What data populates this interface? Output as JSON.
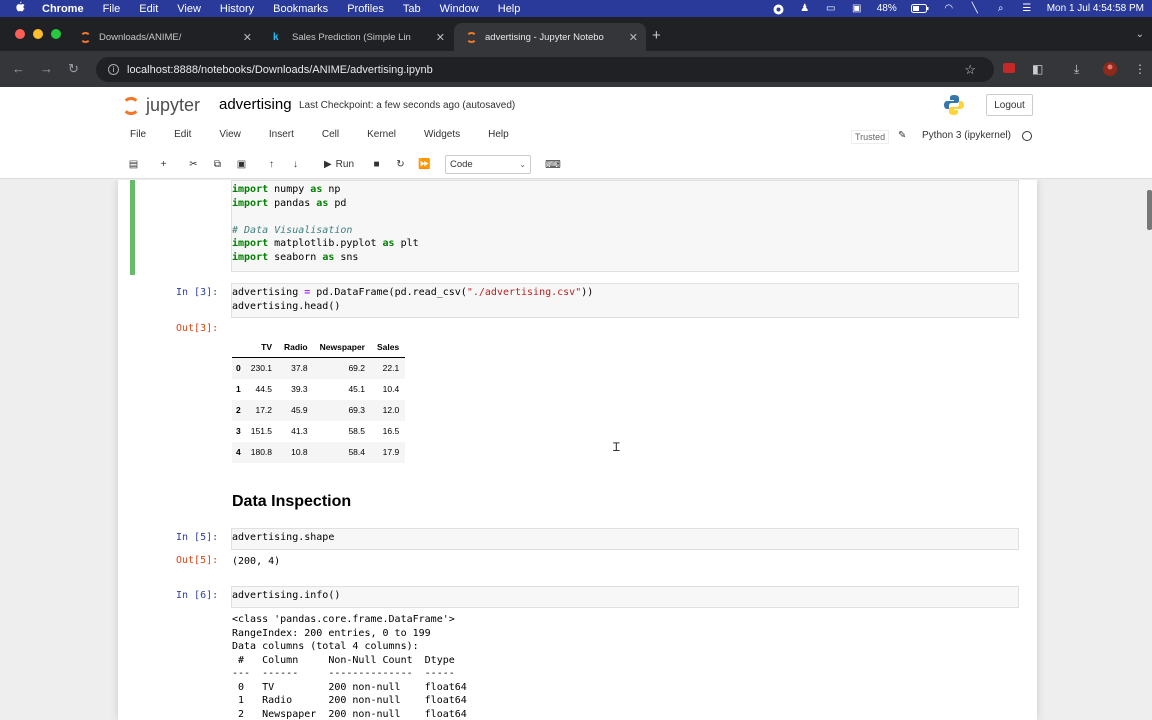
{
  "menubar": {
    "apple": "",
    "items": [
      "Chrome",
      "File",
      "Edit",
      "View",
      "History",
      "Bookmarks",
      "Profiles",
      "Tab",
      "Window",
      "Help"
    ],
    "battery": "48%",
    "clock": "Mon 1 Jul  4:54:58 PM"
  },
  "browser": {
    "tabs": [
      {
        "title": "Downloads/ANIME/",
        "favicon_color": "#f37626"
      },
      {
        "title": "Sales Prediction (Simple Lin",
        "favicon_color": "#1976d2"
      },
      {
        "title": "advertising - Jupyter Notebo",
        "favicon_color": "#f37626"
      }
    ],
    "active_tab": 2,
    "url": "localhost:8888/notebooks/Downloads/ANIME/advertising.ipynb"
  },
  "jupyter": {
    "logo_text": "jupyter",
    "notebook_name": "advertising",
    "checkpoint": "Last Checkpoint: a few seconds ago  (autosaved)",
    "logout": "Logout",
    "menu": [
      "File",
      "Edit",
      "View",
      "Insert",
      "Cell",
      "Kernel",
      "Widgets",
      "Help"
    ],
    "trusted": "Trusted",
    "kernel_name": "Python 3 (ipykernel)",
    "run_label": "Run",
    "cell_type": "Code"
  },
  "cells": {
    "c1": {
      "lines": [
        "import numpy as np",
        "import pandas as pd",
        "",
        "# Data Visualisation",
        "import matplotlib.pyplot as plt",
        "import seaborn as sns"
      ]
    },
    "c2": {
      "prompt": "In [3]:",
      "out_prompt": "Out[3]:",
      "line1_a": "advertising ",
      "line1_op": "=",
      "line1_b": " pd.DataFrame(pd.read_csv(",
      "line1_str": "\"./advertising.csv\"",
      "line1_c": "))",
      "line2": "advertising.head()",
      "table": {
        "columns": [
          "",
          "TV",
          "Radio",
          "Newspaper",
          "Sales"
        ],
        "rows": [
          [
            "0",
            "230.1",
            "37.8",
            "69.2",
            "22.1"
          ],
          [
            "1",
            "44.5",
            "39.3",
            "45.1",
            "10.4"
          ],
          [
            "2",
            "17.2",
            "45.9",
            "69.3",
            "12.0"
          ],
          [
            "3",
            "151.5",
            "41.3",
            "58.5",
            "16.5"
          ],
          [
            "4",
            "180.8",
            "10.8",
            "58.4",
            "17.9"
          ]
        ]
      }
    },
    "heading": "Data Inspection",
    "c3": {
      "prompt": "In [5]:",
      "code": "advertising.shape",
      "out_prompt": "Out[5]:",
      "output": "(200, 4)"
    },
    "c4": {
      "prompt": "In [6]:",
      "code": "advertising.info()",
      "output_lines": [
        "<class 'pandas.core.frame.DataFrame'>",
        "RangeIndex: 200 entries, 0 to 199",
        "Data columns (total 4 columns):",
        " #   Column     Non-Null Count  Dtype  ",
        "---  ------     --------------  -----  ",
        " 0   TV         200 non-null    float64",
        " 1   Radio      200 non-null    float64",
        " 2   Newspaper  200 non-null    float64"
      ]
    }
  }
}
